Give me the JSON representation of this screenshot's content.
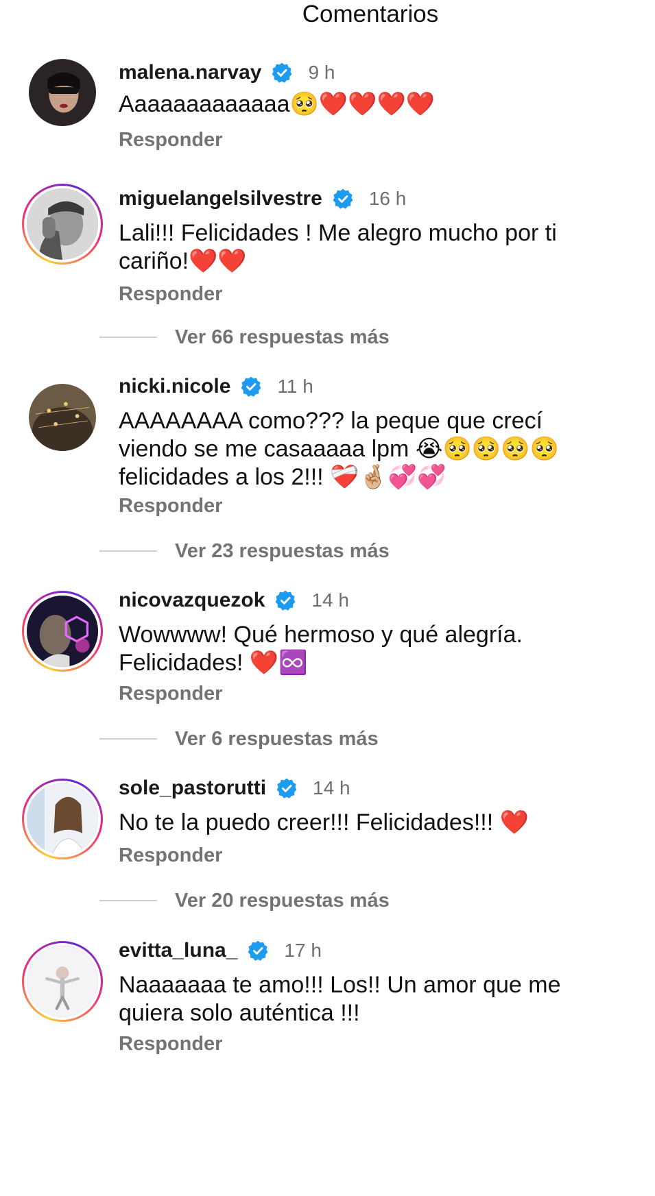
{
  "header": {
    "title": "Comentarios"
  },
  "comments": [
    {
      "username": "malena.narvay",
      "time": "9 h",
      "text_line1": "Aaaaaaaaaaaaa🥺❤️❤️❤️❤️",
      "text_line2": "",
      "text_line3": "",
      "reply_label": "Responder"
    },
    {
      "username": "miguelangelsilvestre",
      "time": "16 h",
      "text_line1": "Lali!!! Felicidades ! Me alegro mucho por ti",
      "text_line2": "cariño!❤️❤️",
      "text_line3": "",
      "reply_label": "Responder",
      "more_replies": "Ver 66 respuestas más"
    },
    {
      "username": "nicki.nicole",
      "time": "11 h",
      "text_line1": "AAAAAAAA como??? la peque que crecí",
      "text_line2": "viendo se me casaaaaa lpm 😭🥺🥺🥺🥺",
      "text_line3": "felicidades a los 2!!! ❤️‍🩹🤞🏼💞💞",
      "reply_label": "Responder",
      "more_replies": "Ver 23 respuestas más"
    },
    {
      "username": "nicovazquezok",
      "time": "14 h",
      "text_line1": "Wowwww! Qué hermoso y qué alegría.",
      "text_line2": "Felicidades! ❤️♾️",
      "text_line3": "",
      "reply_label": "Responder",
      "more_replies": "Ver 6 respuestas más"
    },
    {
      "username": "sole_pastorutti",
      "time": "14 h",
      "text_line1": "No te la puedo creer!!! Felicidades!!! ❤️",
      "text_line2": "",
      "text_line3": "",
      "reply_label": "Responder",
      "more_replies": "Ver 20 respuestas más"
    },
    {
      "username": "evitta_luna_",
      "time": "17 h",
      "text_line1": "Naaaaaaa te amo!!! Los!! Un amor que me",
      "text_line2": "quiera solo auténtica !!!",
      "text_line3": "",
      "reply_label": "Responder"
    }
  ],
  "colors": {
    "verified_blue": "#1d9bf0",
    "meta_gray": "#737373",
    "story_ring": [
      "#f9ce34",
      "#ee2a7b",
      "#6228d7"
    ]
  },
  "icons": {
    "verified": "verified-badge-icon"
  }
}
